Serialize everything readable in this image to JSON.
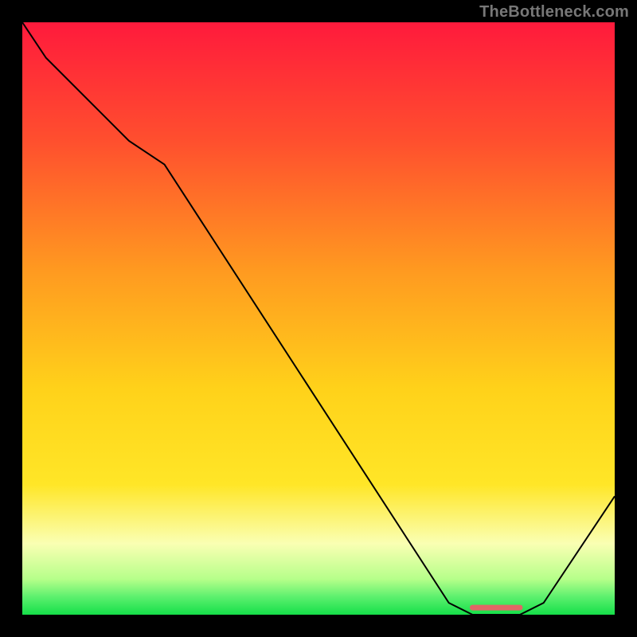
{
  "attribution": "TheBottleneck.com",
  "colors": {
    "frame": "#000000",
    "curve": "#000000",
    "marker": "#e06666",
    "gradient_top": "#ff1a3c",
    "gradient_mid_orange": "#ff8a2a",
    "gradient_yellow": "#ffe627",
    "gradient_pale": "#faffb3",
    "gradient_green": "#15df49"
  },
  "chart_data": {
    "type": "line",
    "xlim": [
      0,
      100
    ],
    "ylim": [
      0,
      100
    ],
    "x": [
      0,
      4,
      18,
      24,
      72,
      76,
      84,
      88,
      100
    ],
    "y": [
      100,
      94,
      80,
      76,
      2,
      0,
      0,
      2,
      20
    ],
    "marker_segment": {
      "x0": 76,
      "x1": 84,
      "y": 1.2
    },
    "title": "",
    "xlabel": "",
    "ylabel": "",
    "notes": "Gradient background from red (top) through orange/yellow to green (bottom); black curve descends from top-left, flattens near bottom-right, then rises. Short pink/red horizontal marker at the trough."
  }
}
